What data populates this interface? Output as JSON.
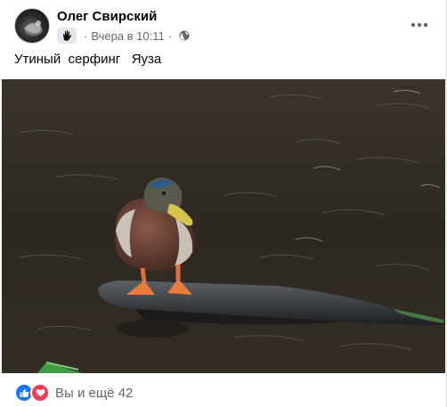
{
  "post": {
    "author": "Олег Свирский",
    "time": "Вчера в 10:11",
    "separator": "·",
    "caption": "Утиный  серфинг   Яуза",
    "reactions_text": "Вы и ещё 42"
  },
  "icons": {
    "avatar": "avatar-image",
    "group_badge": "hand-badge-icon",
    "privacy": "globe-icon",
    "more": "more-options-icon",
    "like": "like-thumb-icon",
    "love": "love-heart-icon"
  },
  "colors": {
    "like": "#1877f2",
    "love": "#f33e58",
    "secondary_text": "#65676b"
  }
}
